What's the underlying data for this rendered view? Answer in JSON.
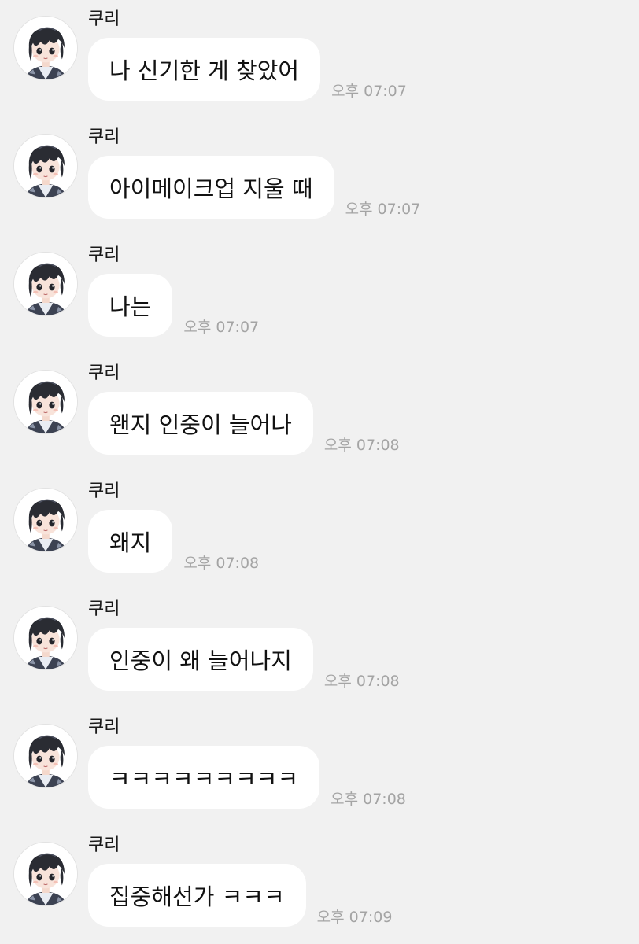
{
  "messages": [
    {
      "sender": "쿠리",
      "text": "나 신기한 게 찾았어",
      "time": "오후 07:07"
    },
    {
      "sender": "쿠리",
      "text": "아이메이크업 지울 때",
      "time": "오후 07:07"
    },
    {
      "sender": "쿠리",
      "text": "나는",
      "time": "오후 07:07"
    },
    {
      "sender": "쿠리",
      "text": "왠지 인중이 늘어나",
      "time": "오후 07:08"
    },
    {
      "sender": "쿠리",
      "text": "왜지",
      "time": "오후 07:08"
    },
    {
      "sender": "쿠리",
      "text": "인중이 왜 늘어나지",
      "time": "오후 07:08"
    },
    {
      "sender": "쿠리",
      "text": "ㅋㅋㅋㅋㅋㅋㅋㅋㅋ",
      "time": "오후 07:08"
    },
    {
      "sender": "쿠리",
      "text": "집중해선가 ㅋㅋㅋ",
      "time": "오후 07:09"
    }
  ],
  "colors": {
    "background": "#f1f1f1",
    "bubble": "#ffffff",
    "timestamp": "#a4a4a4",
    "hair": "#2a2c33"
  },
  "icons": {
    "avatar": "chibi-boy-avatar-icon"
  }
}
